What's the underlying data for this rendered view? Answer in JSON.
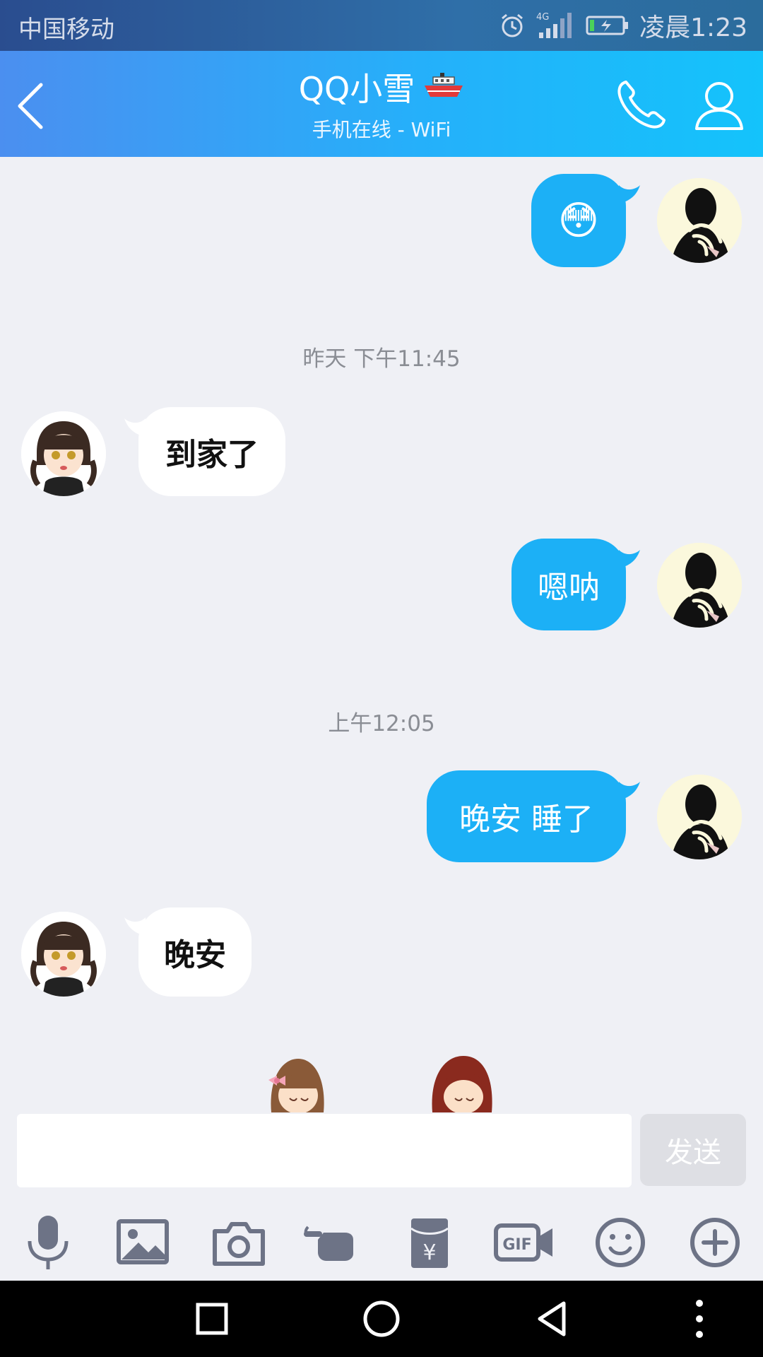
{
  "status_bar": {
    "carrier": "中国移动",
    "network": "4G",
    "time": "凌晨1:23"
  },
  "header": {
    "title": "QQ小雪",
    "subtitle": "手机在线 - WiFi",
    "icons": [
      "back-icon",
      "ship-icon",
      "phone-icon",
      "profile-icon"
    ]
  },
  "chat": {
    "messages": [
      {
        "from": "me",
        "type": "emoji",
        "text": "😳"
      },
      {
        "type": "time",
        "text": "昨天 下午11:45"
      },
      {
        "from": "friend",
        "type": "text",
        "text": "到家了"
      },
      {
        "from": "me",
        "type": "text",
        "text": "嗯呐"
      },
      {
        "type": "time",
        "text": "上午12:05"
      },
      {
        "from": "me",
        "type": "text",
        "text": "晚安 睡了"
      },
      {
        "from": "friend",
        "type": "text",
        "text": "晚安"
      }
    ]
  },
  "input": {
    "value": "",
    "send_label": "发送"
  },
  "toolbar": {
    "items": [
      "mic-icon",
      "image-icon",
      "camera-icon",
      "poke-icon",
      "red-packet-icon",
      "gif-icon",
      "emoji-icon",
      "plus-icon"
    ],
    "gif_label": "GIF"
  },
  "colors": {
    "header_start": "#4b8ff0",
    "header_end": "#14c3fb",
    "my_bubble": "#1cb0f6",
    "friend_bubble": "#ffffff",
    "background": "#eff0f5"
  }
}
